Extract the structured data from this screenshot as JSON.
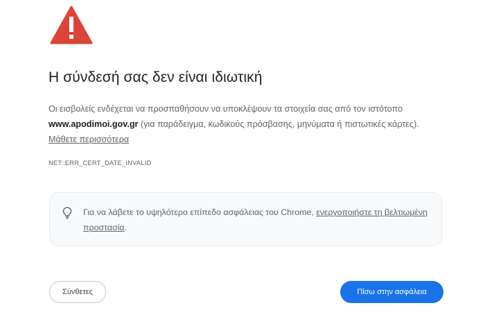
{
  "title": "Η σύνδεσή σας δεν είναι ιδιωτική",
  "description": {
    "part1": "Οι εισβολείς ενδέχεται να προσπαθήσουν να υποκλέψουν τα στοιχεία σας από τον ιστότοπο ",
    "domain": "www.apodimoi.gov.gr",
    "part2": " (για παράδειγμα, κωδικούς πρόσβασης, μηνύματα ή πιστωτικές κάρτες). ",
    "learn_more": "Μάθετε περισσότερα"
  },
  "error_code": "NET::ERR_CERT_DATE_INVALID",
  "tip": {
    "text": "Για να λάβετε το υψηλότερο επίπεδο ασφάλειας του Chrome, ",
    "link": "ενεργοποιήστε τη βελτιωμένη προστασία",
    "end": "."
  },
  "buttons": {
    "advanced": "Σύνθετες",
    "back": "Πίσω στην ασφάλεια"
  },
  "icons": {
    "warning": "warning-triangle-icon",
    "tip": "lightbulb-icon"
  },
  "colors": {
    "warning_red": "#db4437",
    "primary_blue": "#1a73e8"
  }
}
